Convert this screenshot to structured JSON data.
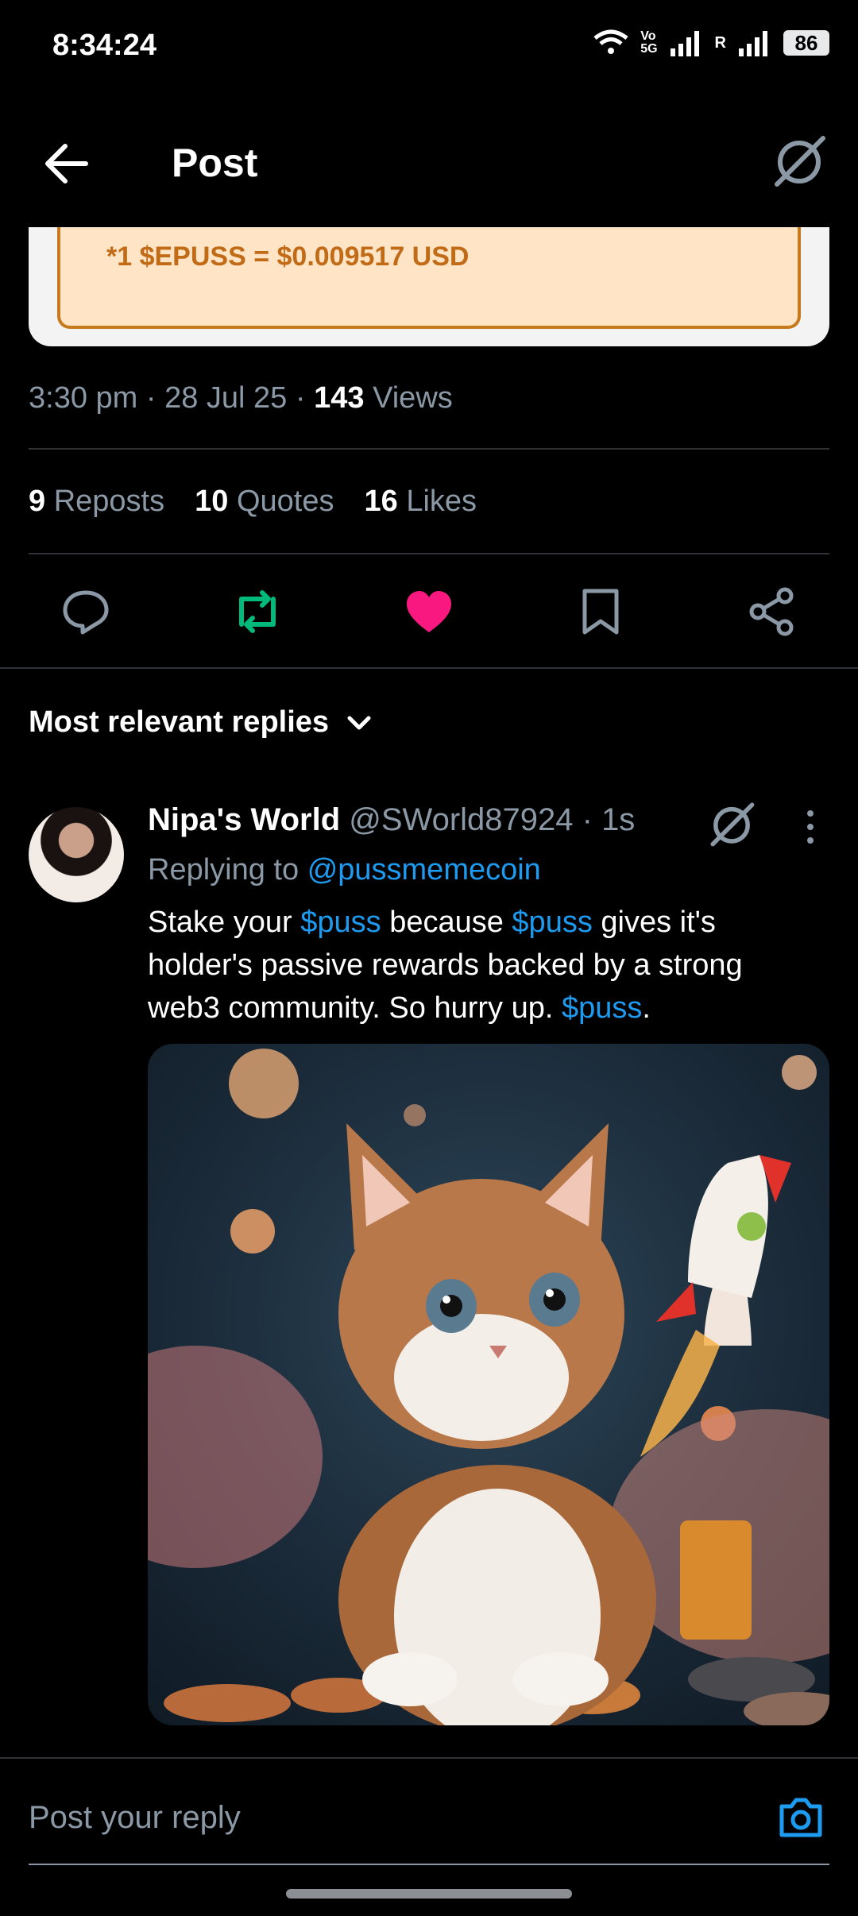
{
  "status_bar": {
    "time": "8:34:24",
    "network_label_1": "Vo",
    "network_label_2": "5G",
    "roaming_label": "R",
    "battery": "86"
  },
  "header": {
    "title": "Post"
  },
  "quoted_card": {
    "text": "*1 $EPUSS = $0.009517 USD"
  },
  "post_meta": {
    "time": "3:30 pm",
    "date": "28 Jul 25",
    "views_count": "143",
    "views_label": "Views"
  },
  "stats": {
    "reposts_count": "9",
    "reposts_label": "Reposts",
    "quotes_count": "10",
    "quotes_label": "Quotes",
    "likes_count": "16",
    "likes_label": "Likes"
  },
  "colors": {
    "repost_active": "#00ba7c",
    "like_active": "#f91880",
    "link": "#1d9bf0"
  },
  "sort": {
    "label": "Most relevant replies"
  },
  "reply": {
    "name": "Nipa's World",
    "handle": "@SWorld87924",
    "age": "1s",
    "replying_prefix": "Replying to",
    "replying_handle": "@pussmemecoin",
    "body": {
      "t1": "Stake your",
      "tag1": "$puss",
      "t2": "because",
      "tag2": "$puss",
      "t3": "gives it's holder's passive rewards backed by a strong web3 community. So hurry up.",
      "tag3": "$puss",
      "t4": "."
    }
  },
  "compose": {
    "placeholder": "Post your reply"
  }
}
